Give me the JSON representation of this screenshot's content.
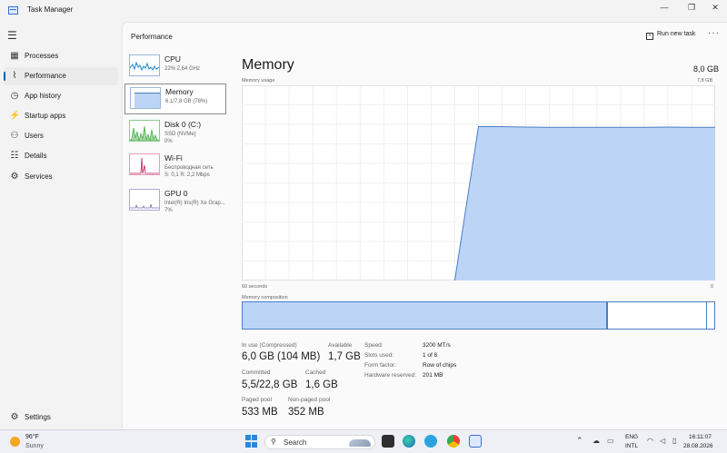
{
  "window": {
    "title": "Task Manager",
    "minimize": "—",
    "maximize": "❐",
    "close": "✕"
  },
  "nav": {
    "items": [
      {
        "label": "Processes",
        "icon": "processes-grid-icon"
      },
      {
        "label": "Performance",
        "icon": "performance-graph-icon"
      },
      {
        "label": "App history",
        "icon": "app-history-icon"
      },
      {
        "label": "Startup apps",
        "icon": "startup-apps-icon"
      },
      {
        "label": "Users",
        "icon": "users-icon"
      },
      {
        "label": "Details",
        "icon": "details-list-icon"
      },
      {
        "label": "Services",
        "icon": "services-gear-icon"
      }
    ],
    "settings": "Settings"
  },
  "header": {
    "title": "Performance",
    "run_new_task": "Run new task",
    "more": "···"
  },
  "devices": [
    {
      "name": "CPU",
      "sub1": "22%  2,64 GHz",
      "sub2": "",
      "color": "#1a86c8"
    },
    {
      "name": "Memory",
      "sub1": "6,1/7,8 GB (78%)",
      "sub2": "",
      "color": "#4a7ec2"
    },
    {
      "name": "Disk 0 (C:)",
      "sub1": "SSD (NVMe)",
      "sub2": "0%",
      "color": "#4caf50"
    },
    {
      "name": "Wi-Fi",
      "sub1": "Беспроводная сеть",
      "sub2": "S: 0,1  R: 2,2 Mbps",
      "color": "#c2185b"
    },
    {
      "name": "GPU 0",
      "sub1": "Intel(R) Iris(R) Xe Grap...",
      "sub2": "7%",
      "color": "#7b68b8"
    }
  ],
  "memory": {
    "title": "Memory",
    "total": "8,0 GB",
    "usage_label": "Memory usage",
    "usage_max": "7,8 GB",
    "graph_left": "60 seconds",
    "graph_right": "0",
    "composition_label": "Memory composition",
    "composition": {
      "in_use_fraction": 0.775,
      "standby_end_fraction": 0.985
    },
    "stats": {
      "in_use_label": "In use (Compressed)",
      "in_use_value": "6,0 GB (104 MB)",
      "available_label": "Available",
      "available_value": "1,7 GB",
      "committed_label": "Committed",
      "committed_value": "5,5/22,8 GB",
      "cached_label": "Cached",
      "cached_value": "1,6 GB",
      "paged_label": "Paged pool",
      "paged_value": "533 MB",
      "nonpaged_label": "Non-paged pool",
      "nonpaged_value": "352 MB"
    },
    "specs": [
      {
        "label": "Speed:",
        "value": "3200 MT/s"
      },
      {
        "label": "Slots used:",
        "value": "1 of 8"
      },
      {
        "label": "Form factor:",
        "value": "Row of chips"
      },
      {
        "label": "Hardware reserved:",
        "value": "201 MB"
      }
    ]
  },
  "chart_data": {
    "type": "area",
    "title": "",
    "xlabel": "60 seconds",
    "ylabel": "Memory usage",
    "x": [
      60,
      57,
      54,
      51,
      48,
      45,
      42,
      39,
      36,
      33,
      30,
      27,
      24,
      21,
      18,
      15,
      12,
      9,
      6,
      3,
      0
    ],
    "xlim": [
      60,
      0
    ],
    "ylim": [
      0,
      7.8
    ],
    "series": [
      {
        "values": [
          null,
          null,
          null,
          null,
          null,
          null,
          null,
          null,
          null,
          0,
          6.15,
          6.15,
          6.13,
          6.12,
          6.12,
          6.12,
          6.12,
          6.12,
          6.13,
          6.12,
          6.12
        ]
      }
    ],
    "grid": true,
    "fill_color": "#bcd5f7",
    "line_color": "#4a7ec2"
  },
  "taskbar": {
    "weather_temp": "96°F",
    "weather_desc": "Sunny",
    "search": "Search",
    "lang1": "ENG",
    "lang2": "INTL",
    "time": "16:11:07",
    "date": "28.08.2026"
  }
}
